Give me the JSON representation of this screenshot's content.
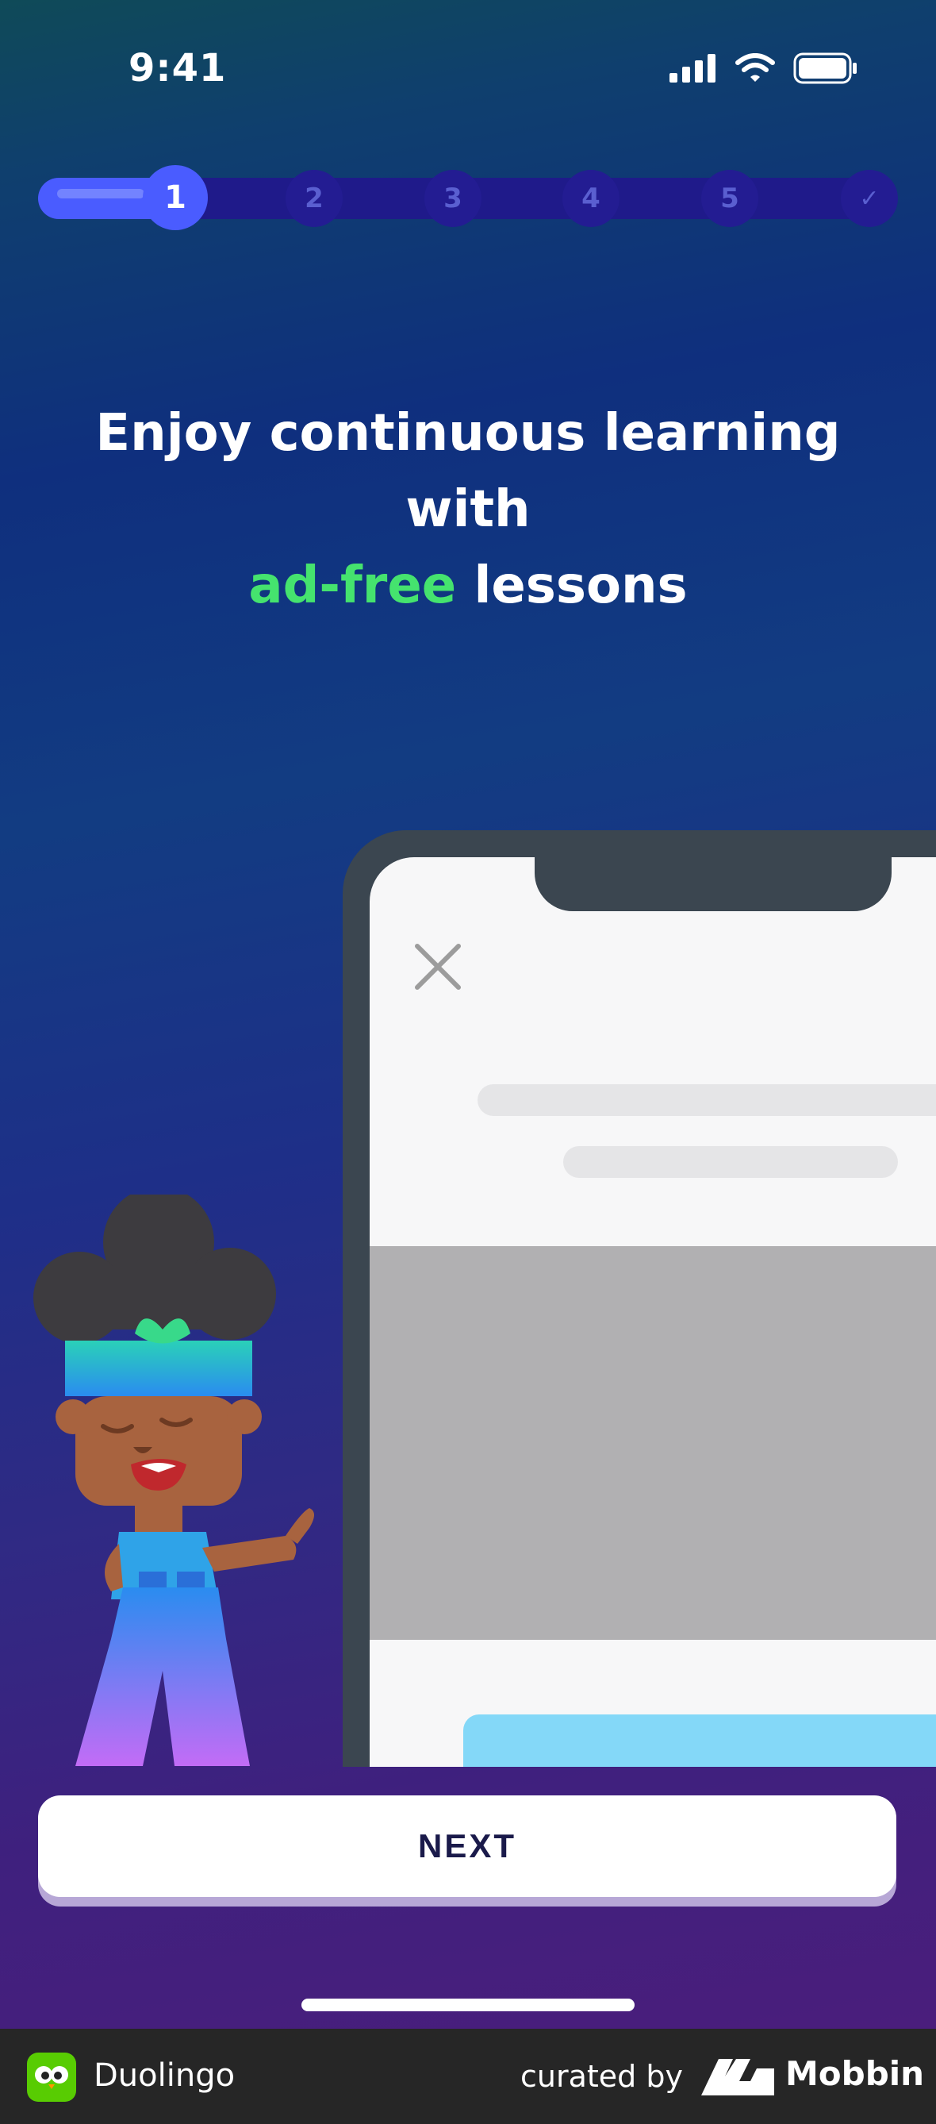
{
  "status_bar": {
    "time": "9:41"
  },
  "progress": {
    "steps": [
      "1",
      "2",
      "3",
      "4",
      "5",
      "✓"
    ],
    "current_step": 1,
    "total_steps": 6
  },
  "headline": {
    "line1": "Enjoy continuous learning with",
    "highlight": "ad-free",
    "line2_rest": " lessons",
    "highlight_color": "#45e36e"
  },
  "actions": {
    "next_label": "NEXT"
  },
  "footer": {
    "app_name": "Duolingo",
    "curated_by": "curated by",
    "brand": "Mobbin"
  },
  "colors": {
    "accent": "#4a5cff",
    "progress_track": "#1f1a8a",
    "button_text": "#1a1a4a",
    "footer_bg": "#262626"
  },
  "icons": {
    "signal": "cellular-signal-icon",
    "wifi": "wifi-icon",
    "battery": "battery-icon",
    "close": "close-icon",
    "check": "checkmark-icon"
  }
}
